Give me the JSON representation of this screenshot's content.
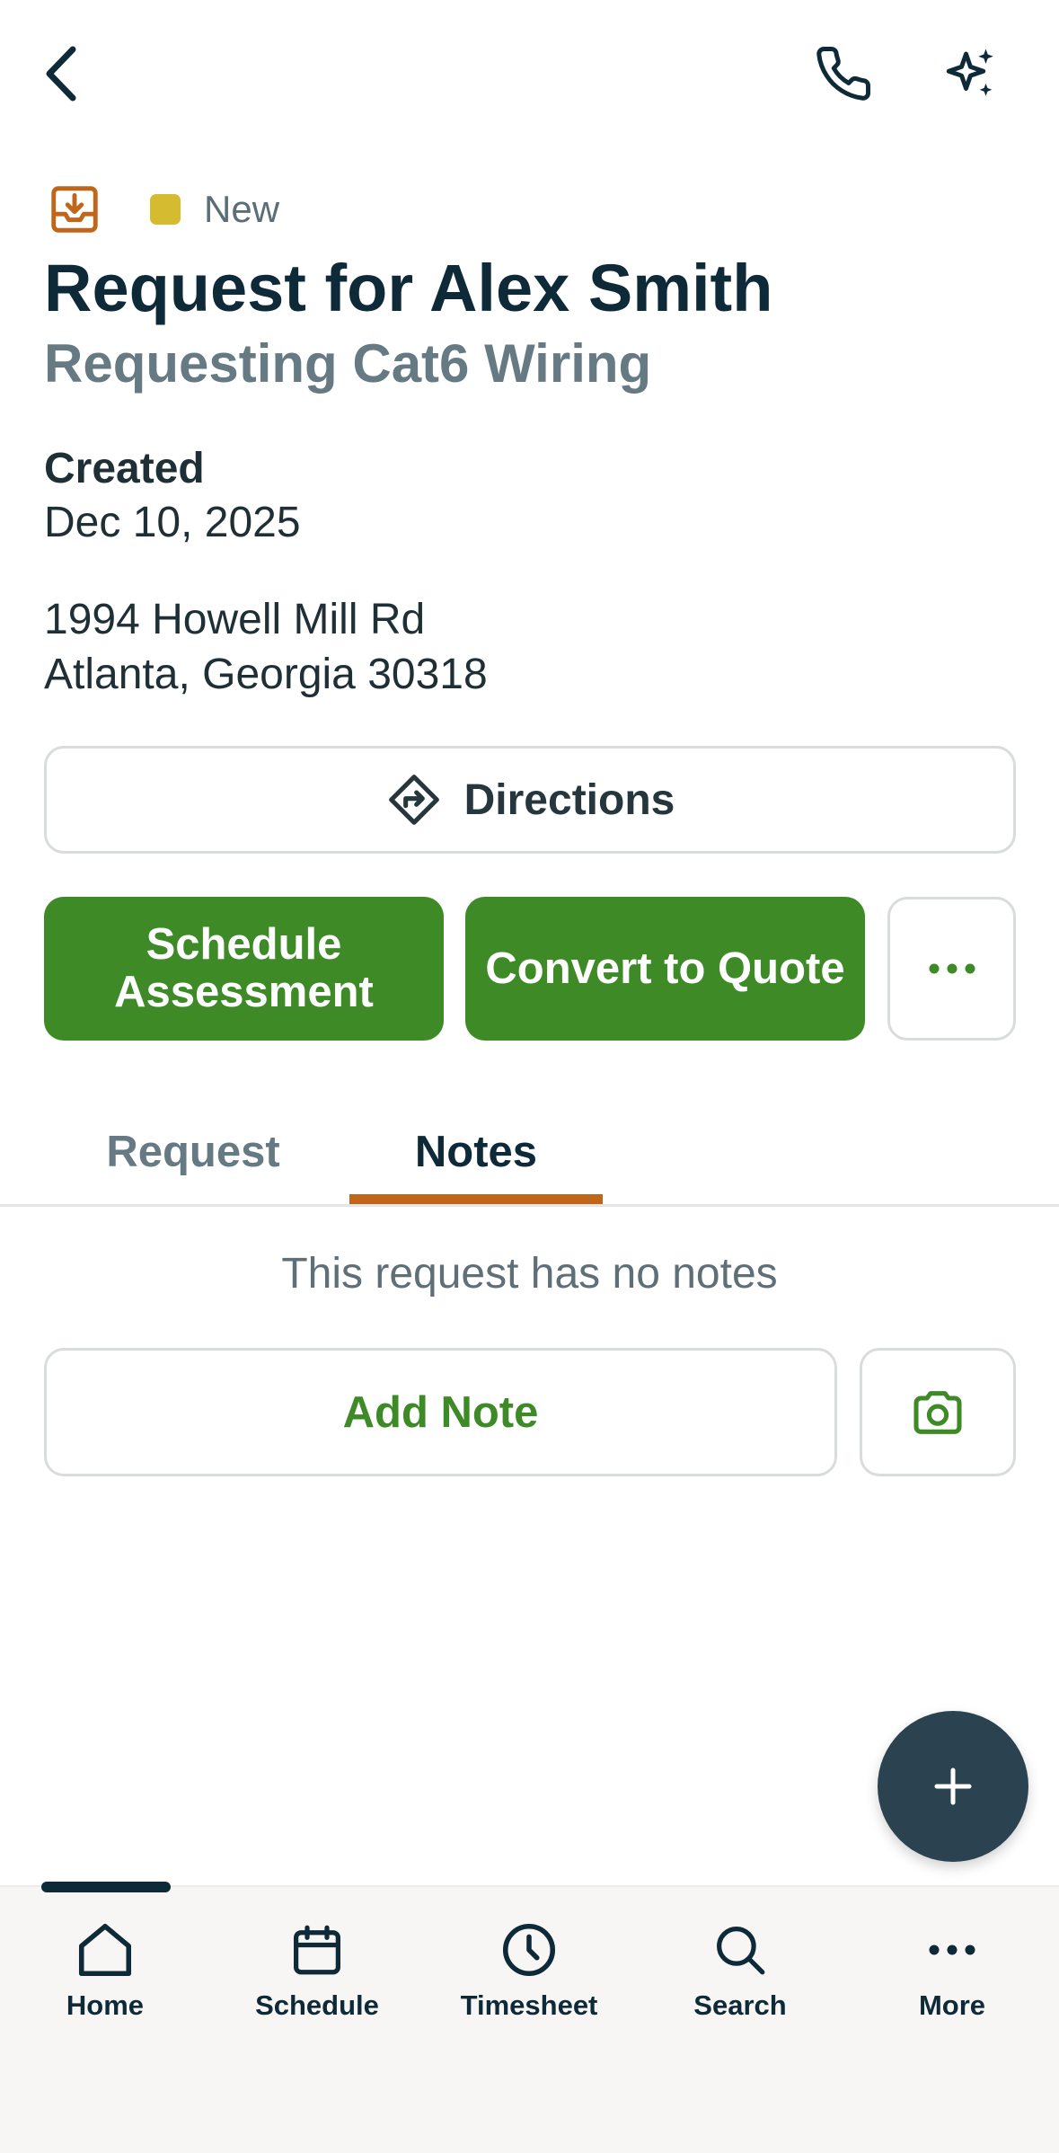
{
  "header": {
    "back_icon": "chevron-left-icon",
    "phone_icon": "phone-icon",
    "ai_icon": "sparkles-icon"
  },
  "request": {
    "status": "New",
    "status_color": "#d4bb2f",
    "type_icon": "inbox-download-icon",
    "type_icon_color": "#c0661b",
    "title": "Request for Alex Smith",
    "subtitle": "Requesting Cat6 Wiring",
    "created_label": "Created",
    "created_value": "Dec 10, 2025",
    "address_line1": "1994 Howell Mill Rd",
    "address_line2": "Atlanta, Georgia 30318"
  },
  "actions": {
    "directions_label": "Directions",
    "schedule_line1": "Schedule",
    "schedule_line2": "Assessment",
    "convert_label": "Convert to Quote",
    "more_icon": "ellipsis-icon",
    "primary_color": "#3d8a27"
  },
  "tabs": [
    {
      "label": "Request",
      "active": false
    },
    {
      "label": "Notes",
      "active": true
    }
  ],
  "tab_accent_color": "#c0661b",
  "notes": {
    "empty_text": "This request has no notes",
    "add_note_label": "Add Note",
    "camera_icon": "camera-icon"
  },
  "fab": {
    "icon": "plus-icon",
    "color": "#2b4350"
  },
  "bottom_nav": [
    {
      "label": "Home",
      "icon": "home-icon",
      "active": true
    },
    {
      "label": "Schedule",
      "icon": "calendar-icon",
      "active": false
    },
    {
      "label": "Timesheet",
      "icon": "clock-icon",
      "active": false
    },
    {
      "label": "Search",
      "icon": "search-icon",
      "active": false
    },
    {
      "label": "More",
      "icon": "ellipsis-icon",
      "active": false
    }
  ]
}
